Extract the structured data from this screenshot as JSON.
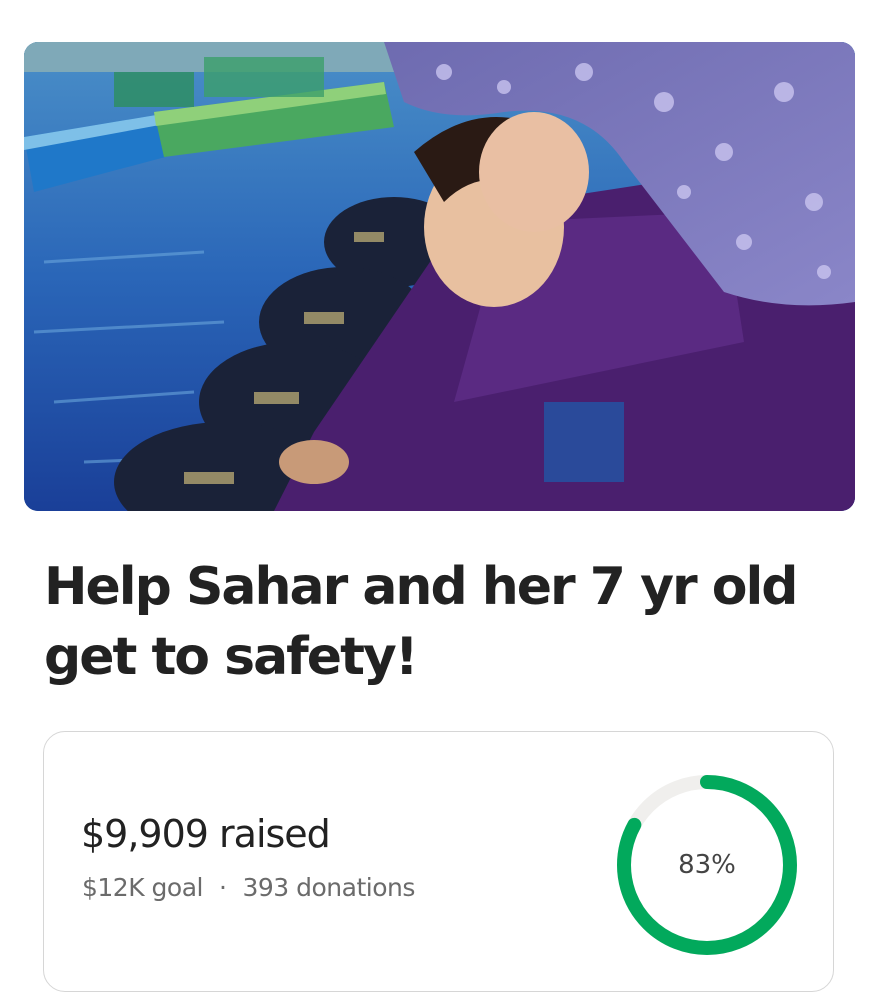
{
  "campaign": {
    "title": "Help Sahar and her 7 yr old get to safety!",
    "hero_image": "photo-woman-and-child-at-harbor"
  },
  "progress": {
    "raised_text": "$9,909 raised",
    "goal_text": "$12K goal",
    "separator": "·",
    "donations_text": "393 donations",
    "percent_text": "83%",
    "percent_value": 0.83,
    "ring_color": "#02a95c",
    "ring_track_color": "#f0efed"
  }
}
